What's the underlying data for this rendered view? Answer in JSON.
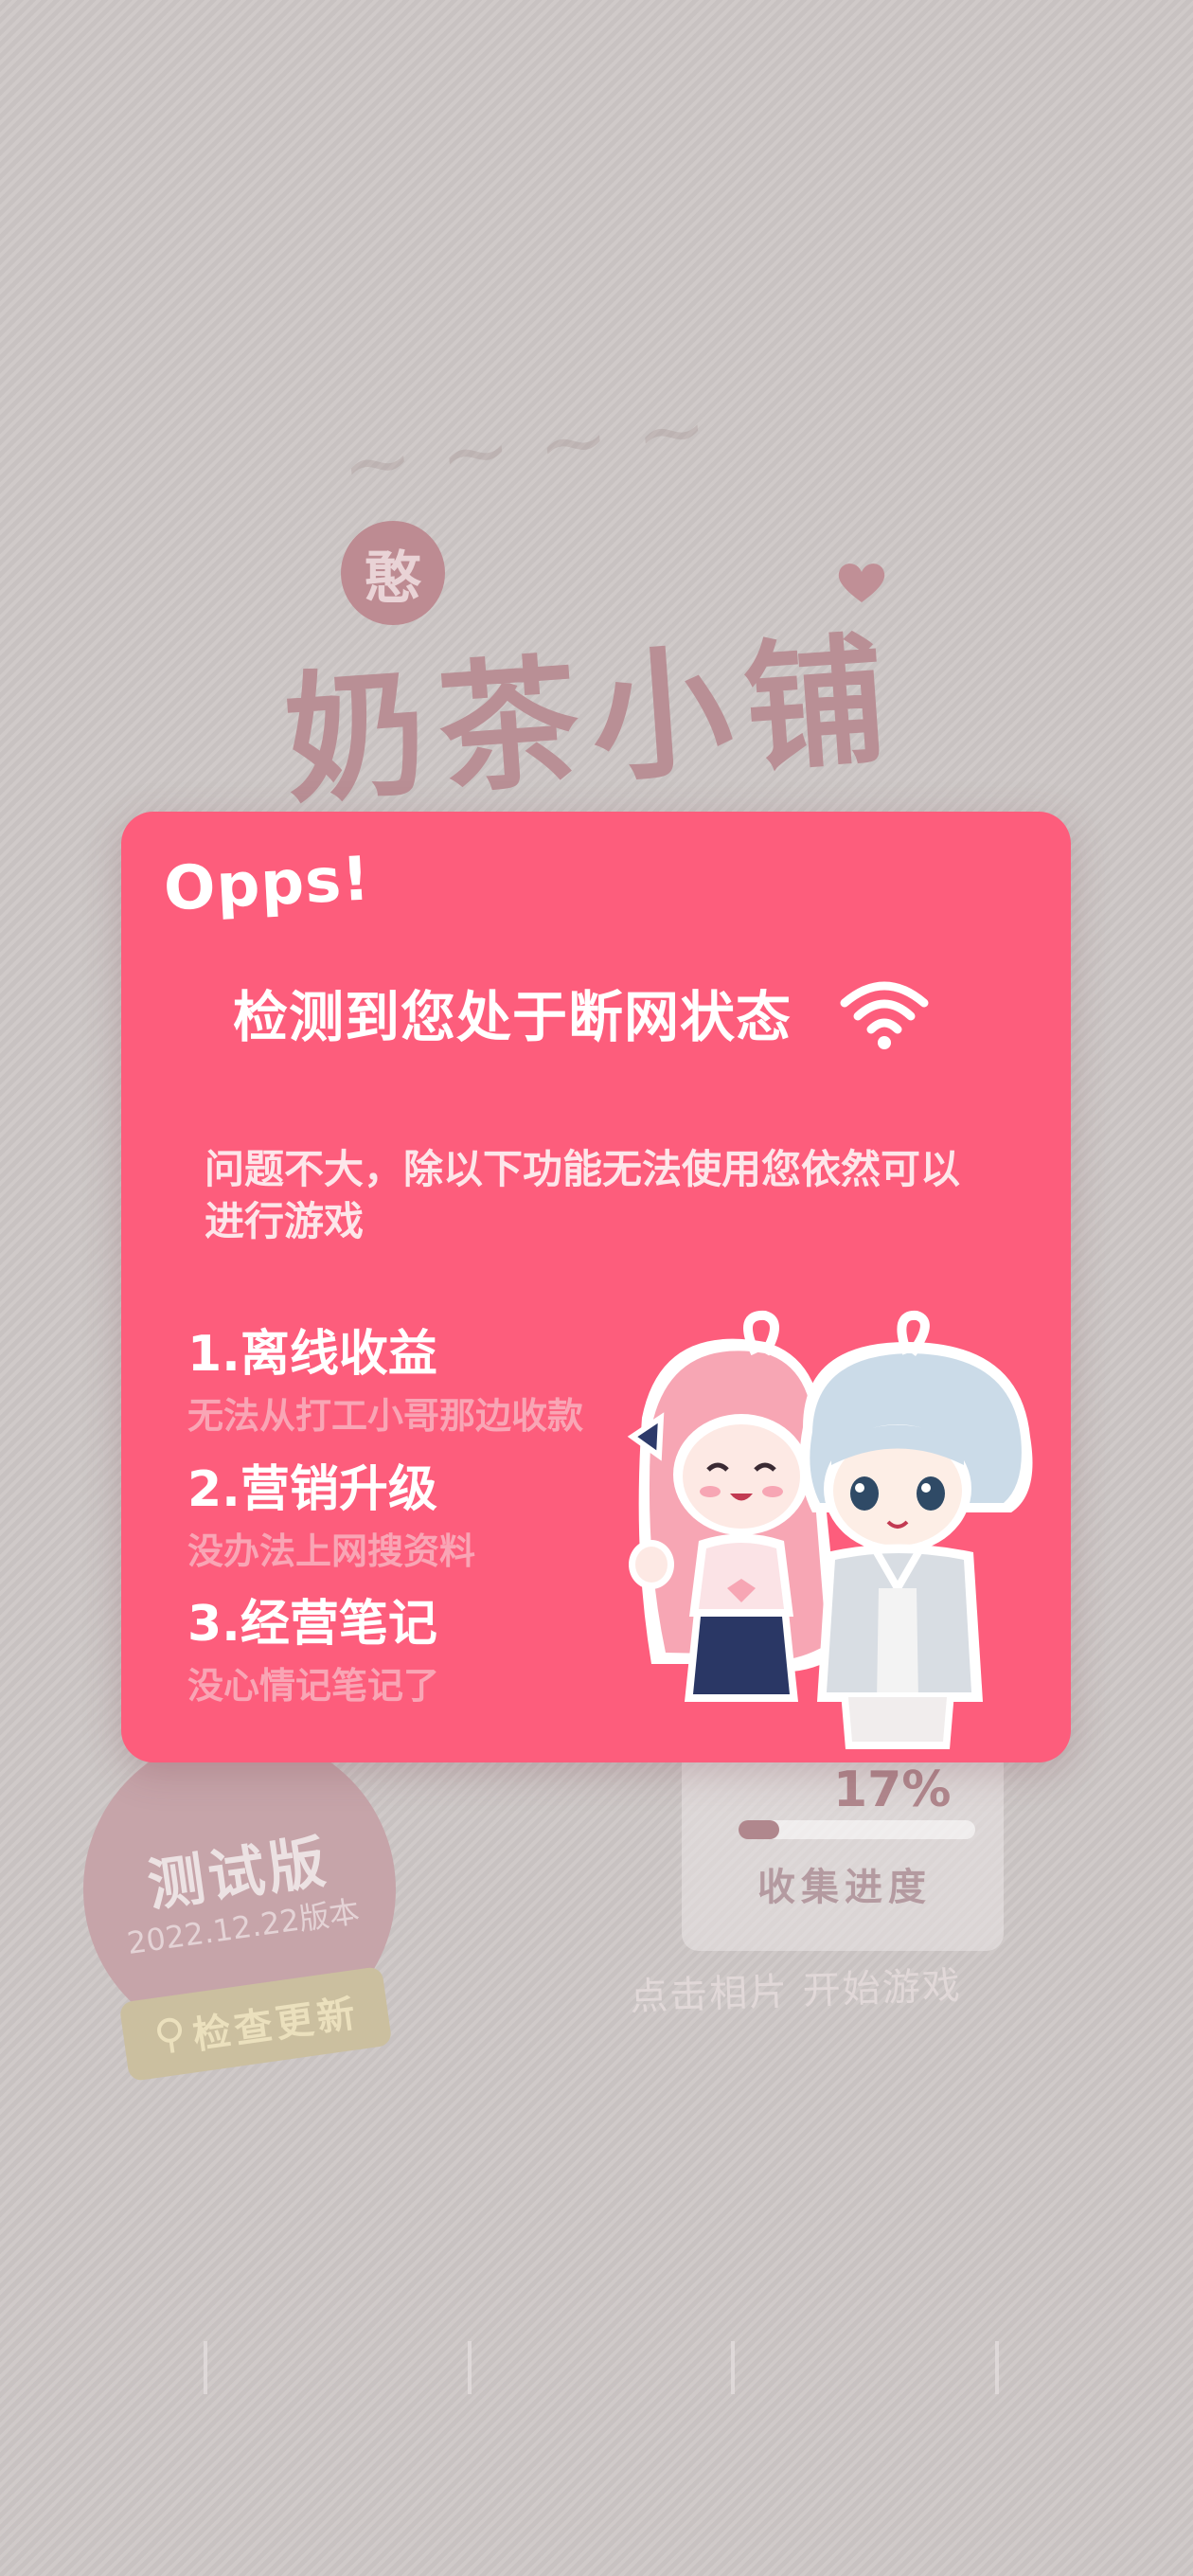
{
  "background": {
    "logo_seal": "憨",
    "logo_title": "奶茶小铺",
    "collection_progress_percent": "17%",
    "collection_progress_value": 0.17,
    "collection_progress_label": "收集进度",
    "start_hint": "点击相片 开始游戏",
    "version_title": "测试版",
    "version_date": "2022.12.22版本",
    "update_button_label": "检查更新",
    "nav_items": [
      "",
      "",
      ""
    ]
  },
  "dialog": {
    "exclaim": "Opps!",
    "title": "检测到您处于断网状态",
    "description": "问题不大，除以下功能无法使用您依然可以进行游戏",
    "features": [
      {
        "title": "1.离线收益",
        "subtitle": "无法从打工小哥那边收款"
      },
      {
        "title": "2.营销升级",
        "subtitle": "没办法上网搜资料"
      },
      {
        "title": "3.经营笔记",
        "subtitle": "没心情记笔记了"
      }
    ]
  },
  "colors": {
    "dialog_bg": "#fd5d7c",
    "overlay": "#cdc7c6",
    "accent_muted": "#b98f95"
  },
  "icons": [
    "wifi-icon",
    "heart-icon",
    "update-icon"
  ]
}
